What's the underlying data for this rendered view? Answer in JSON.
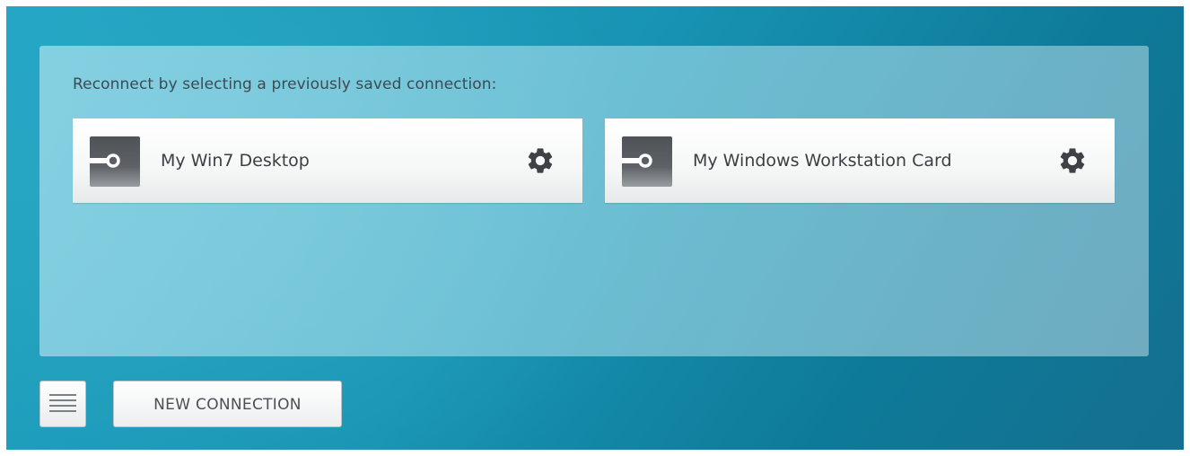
{
  "panel": {
    "heading": "Reconnect by selecting a previously saved connection:",
    "connections": [
      {
        "label": "My Win7 Desktop",
        "icon": "connection-icon",
        "settings_icon": "gear-icon"
      },
      {
        "label": "My Windows Workstation Card",
        "icon": "connection-icon",
        "settings_icon": "gear-icon"
      }
    ]
  },
  "footer": {
    "menu_icon": "hamburger-menu-icon",
    "new_connection_label": "NEW CONNECTION"
  },
  "colors": {
    "background_accent": "#1893b3",
    "panel": "#8fd0e0",
    "card_text": "#3a3f44",
    "icon_dark": "#4a4d50"
  }
}
